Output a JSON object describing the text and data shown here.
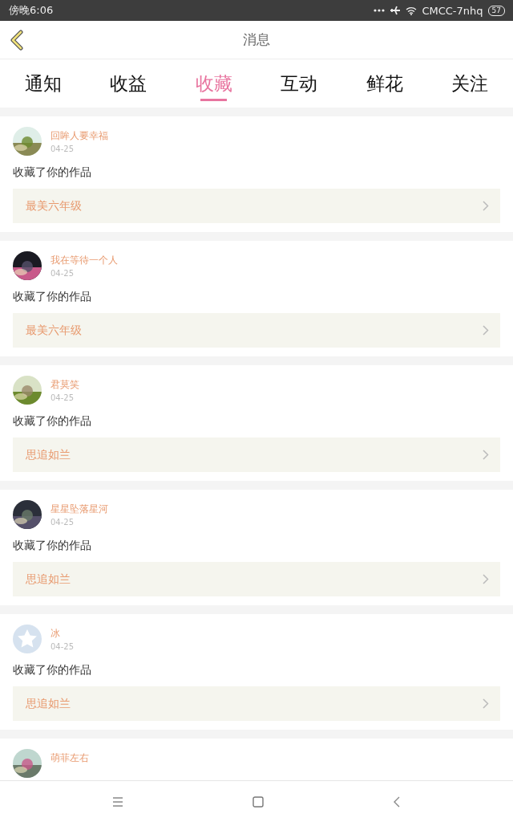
{
  "status_bar": {
    "time": "傍晚6:06",
    "carrier": "CMCC-7nhq",
    "battery": "57"
  },
  "header": {
    "title": "消息"
  },
  "tabs": [
    {
      "label": "通知",
      "selected": false
    },
    {
      "label": "收益",
      "selected": false
    },
    {
      "label": "收藏",
      "selected": true
    },
    {
      "label": "互动",
      "selected": false
    },
    {
      "label": "鲜花",
      "selected": false
    },
    {
      "label": "关注",
      "selected": false
    }
  ],
  "messages": [
    {
      "name": "回眸人要幸福",
      "date": "04-25",
      "text": "收藏了你的作品",
      "work": "最美六年级"
    },
    {
      "name": "我在等待一个人",
      "date": "04-25",
      "text": "收藏了你的作品",
      "work": "最美六年级"
    },
    {
      "name": "君莫笑",
      "date": "04-25",
      "text": "收藏了你的作品",
      "work": "思追如兰"
    },
    {
      "name": "星星坠落星河",
      "date": "04-25",
      "text": "收藏了你的作品",
      "work": "思追如兰"
    },
    {
      "kind": "default",
      "name": "冰",
      "date": "04-25",
      "text": "收藏了你的作品",
      "work": "思追如兰"
    },
    {
      "name": "萌菲左右"
    }
  ]
}
